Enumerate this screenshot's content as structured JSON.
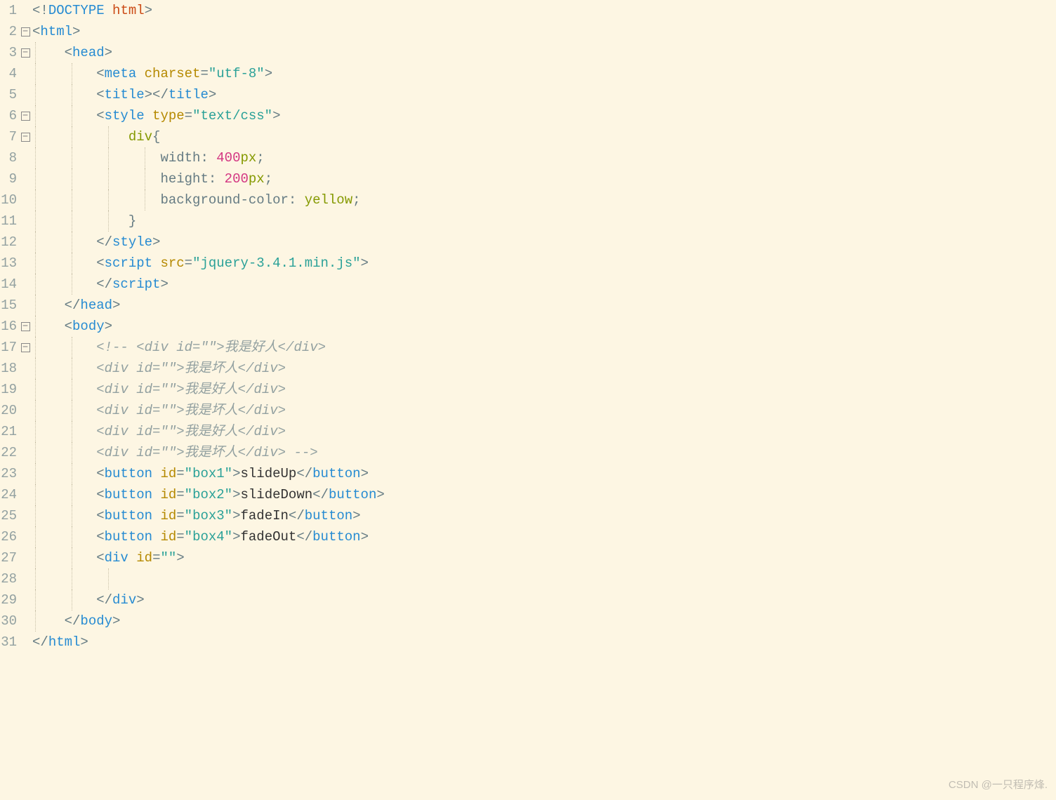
{
  "watermark": "CSDN @一只程序烽.",
  "fold_marks": {
    "2": "minus",
    "3": "minus",
    "6": "minus",
    "7": "minus",
    "16": "minus",
    "17": "minus"
  },
  "lines": [
    {
      "n": "1",
      "g": [],
      "h": "<span class='punct'>&lt;!</span><span class='tag'>DOCTYPE</span> <span class='doctype'>html</span><span class='punct'>&gt;</span>"
    },
    {
      "n": "2",
      "g": [],
      "h": "<span class='punct'>&lt;</span><span class='tag'>html</span><span class='punct'>&gt;</span>"
    },
    {
      "n": "3",
      "g": [
        0
      ],
      "h": "    <span class='punct'>&lt;</span><span class='tag'>head</span><span class='punct'>&gt;</span>"
    },
    {
      "n": "4",
      "g": [
        0,
        1
      ],
      "h": "        <span class='punct'>&lt;</span><span class='tag'>meta</span> <span class='attr'>charset</span><span class='punct'>=</span><span class='str'>\"utf-8\"</span><span class='punct'>&gt;</span>"
    },
    {
      "n": "5",
      "g": [
        0,
        1
      ],
      "h": "        <span class='punct'>&lt;</span><span class='tag'>title</span><span class='punct'>&gt;&lt;/</span><span class='tag'>title</span><span class='punct'>&gt;</span>"
    },
    {
      "n": "6",
      "g": [
        0,
        1
      ],
      "h": "        <span class='punct'>&lt;</span><span class='tag'>style</span> <span class='attr'>type</span><span class='punct'>=</span><span class='str'>\"text/css\"</span><span class='punct'>&gt;</span>"
    },
    {
      "n": "7",
      "g": [
        0,
        1,
        2
      ],
      "h": "            <span class='kw'>div</span><span class='punct'>{</span>"
    },
    {
      "n": "8",
      "g": [
        0,
        1,
        2,
        3
      ],
      "h": "                <span class='prop'>width</span><span class='punct'>:</span> <span class='num'>400</span><span class='kw'>px</span><span class='punct'>;</span>"
    },
    {
      "n": "9",
      "g": [
        0,
        1,
        2,
        3
      ],
      "h": "                <span class='prop'>height</span><span class='punct'>:</span> <span class='num'>200</span><span class='kw'>px</span><span class='punct'>;</span>"
    },
    {
      "n": "10",
      "g": [
        0,
        1,
        2,
        3
      ],
      "h": "                <span class='prop'>background-color</span><span class='punct'>:</span> <span class='kw'>yellow</span><span class='punct'>;</span>"
    },
    {
      "n": "11",
      "g": [
        0,
        1,
        2
      ],
      "h": "            <span class='punct'>}</span>"
    },
    {
      "n": "12",
      "g": [
        0,
        1
      ],
      "h": "        <span class='punct'>&lt;/</span><span class='tag'>style</span><span class='punct'>&gt;</span>"
    },
    {
      "n": "13",
      "g": [
        0,
        1
      ],
      "h": "        <span class='punct'>&lt;</span><span class='tag'>script</span> <span class='attr'>src</span><span class='punct'>=</span><span class='str'>\"jquery-3.4.1.min.js\"</span><span class='punct'>&gt;</span>"
    },
    {
      "n": "14",
      "g": [
        0,
        1
      ],
      "h": "        <span class='punct'>&lt;/</span><span class='tag'>script</span><span class='punct'>&gt;</span>"
    },
    {
      "n": "15",
      "g": [
        0
      ],
      "h": "    <span class='punct'>&lt;/</span><span class='tag'>head</span><span class='punct'>&gt;</span>"
    },
    {
      "n": "16",
      "g": [
        0
      ],
      "h": "    <span class='punct'>&lt;</span><span class='tag'>body</span><span class='punct'>&gt;</span>"
    },
    {
      "n": "17",
      "g": [
        0,
        1
      ],
      "h": "        <span class='comment'>&lt;!-- &lt;div id=\"\"&gt;我是好人&lt;/div&gt;</span>"
    },
    {
      "n": "18",
      "g": [
        0,
        1
      ],
      "h": "        <span class='comment'>&lt;div id=\"\"&gt;我是坏人&lt;/div&gt;</span>"
    },
    {
      "n": "19",
      "g": [
        0,
        1
      ],
      "h": "        <span class='comment'>&lt;div id=\"\"&gt;我是好人&lt;/div&gt;</span>"
    },
    {
      "n": "20",
      "g": [
        0,
        1
      ],
      "h": "        <span class='comment'>&lt;div id=\"\"&gt;我是坏人&lt;/div&gt;</span>"
    },
    {
      "n": "21",
      "g": [
        0,
        1
      ],
      "h": "        <span class='comment'>&lt;div id=\"\"&gt;我是好人&lt;/div&gt;</span>"
    },
    {
      "n": "22",
      "g": [
        0,
        1
      ],
      "h": "        <span class='comment'>&lt;div id=\"\"&gt;我是坏人&lt;/div&gt; --&gt;</span>"
    },
    {
      "n": "23",
      "g": [
        0,
        1
      ],
      "h": "        <span class='punct'>&lt;</span><span class='tag'>button</span> <span class='attr'>id</span><span class='punct'>=</span><span class='str'>\"box1\"</span><span class='punct'>&gt;</span><span class='text'>slideUp</span><span class='punct'>&lt;/</span><span class='tag'>button</span><span class='punct'>&gt;</span>"
    },
    {
      "n": "24",
      "g": [
        0,
        1
      ],
      "h": "        <span class='punct'>&lt;</span><span class='tag'>button</span> <span class='attr'>id</span><span class='punct'>=</span><span class='str'>\"box2\"</span><span class='punct'>&gt;</span><span class='text'>slideDown</span><span class='punct'>&lt;/</span><span class='tag'>button</span><span class='punct'>&gt;</span>"
    },
    {
      "n": "25",
      "g": [
        0,
        1
      ],
      "h": "        <span class='punct'>&lt;</span><span class='tag'>button</span> <span class='attr'>id</span><span class='punct'>=</span><span class='str'>\"box3\"</span><span class='punct'>&gt;</span><span class='text'>fadeIn</span><span class='punct'>&lt;/</span><span class='tag'>button</span><span class='punct'>&gt;</span>"
    },
    {
      "n": "26",
      "g": [
        0,
        1
      ],
      "h": "        <span class='punct'>&lt;</span><span class='tag'>button</span> <span class='attr'>id</span><span class='punct'>=</span><span class='str'>\"box4\"</span><span class='punct'>&gt;</span><span class='text'>fadeOut</span><span class='punct'>&lt;/</span><span class='tag'>button</span><span class='punct'>&gt;</span>"
    },
    {
      "n": "27",
      "g": [
        0,
        1
      ],
      "h": "        <span class='punct'>&lt;</span><span class='tag'>div</span> <span class='attr'>id</span><span class='punct'>=</span><span class='str'>\"\"</span><span class='punct'>&gt;</span>"
    },
    {
      "n": "28",
      "g": [
        0,
        1,
        2
      ],
      "h": "            "
    },
    {
      "n": "29",
      "g": [
        0,
        1
      ],
      "h": "        <span class='punct'>&lt;/</span><span class='tag'>div</span><span class='punct'>&gt;</span>"
    },
    {
      "n": "30",
      "g": [
        0
      ],
      "h": "    <span class='punct'>&lt;/</span><span class='tag'>body</span><span class='punct'>&gt;</span>"
    },
    {
      "n": "31",
      "g": [],
      "h": "<span class='punct'>&lt;/</span><span class='tag'>html</span><span class='punct'>&gt;</span>"
    }
  ]
}
